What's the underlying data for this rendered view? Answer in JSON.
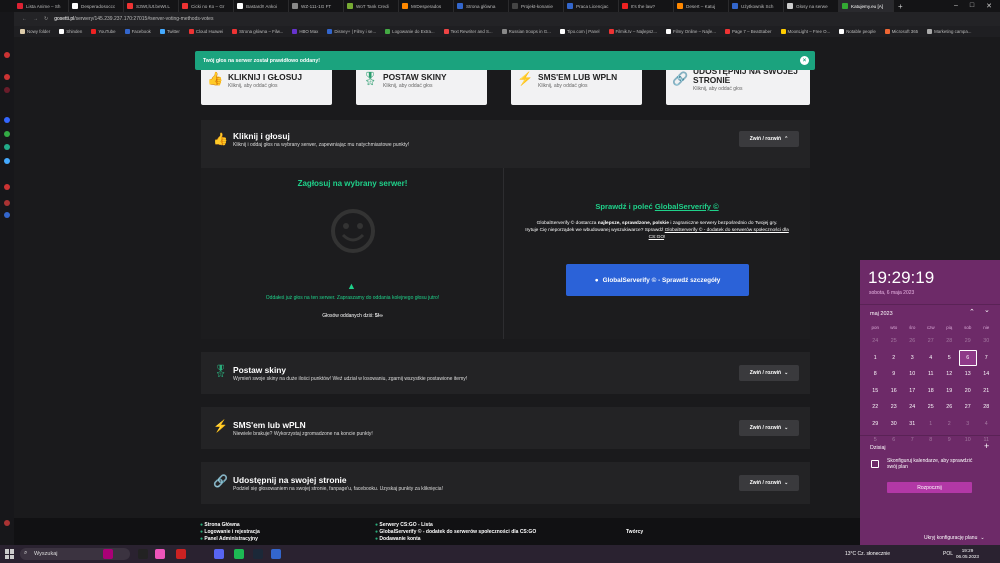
{
  "tabs": [
    {
      "label": "Lista Anime – Sh",
      "color": "#d23"
    },
    {
      "label": "Desperadosoccc",
      "color": "#fff"
    },
    {
      "label": "S3Wt,lUt.beWI.L",
      "color": "#e33"
    },
    {
      "label": "Cicki no Ko – Gr",
      "color": "#e33"
    },
    {
      "label": "Bastard!! Ankoi",
      "color": "#fff"
    },
    {
      "label": "WZ-111-1G FT",
      "color": "#888"
    },
    {
      "label": "WoT Tank Credi",
      "color": "#7a3"
    },
    {
      "label": "MrDesperados",
      "color": "#f80"
    },
    {
      "label": "Strona główna",
      "color": "#36c"
    },
    {
      "label": "Projekt-konanie",
      "color": "#444"
    },
    {
      "label": "Praca Licencjac",
      "color": "#36c"
    },
    {
      "label": "It's the law?",
      "color": "#e22"
    },
    {
      "label": "Desert – Katuj",
      "color": "#f80"
    },
    {
      "label": "Użytkownik Sch",
      "color": "#36c"
    },
    {
      "label": "Głosy na serwe",
      "color": "#ccc"
    },
    {
      "label": "Katujemy.eu [A]",
      "color": "#3a3"
    }
  ],
  "url": {
    "host": "gosetti.pl",
    "path": "/serwery/145.239.237.170:27015#server-voting-methods-votes"
  },
  "bookmarks": [
    {
      "label": "Nowy folder",
      "color": "#dca"
    },
    {
      "label": "Shinden",
      "color": "#fff"
    },
    {
      "label": "YouTube",
      "color": "#e22"
    },
    {
      "label": "Facebook",
      "color": "#36c"
    },
    {
      "label": "Twitter",
      "color": "#4af"
    },
    {
      "label": "Cloud Huawei",
      "color": "#e33"
    },
    {
      "label": "Strona główna – Filw...",
      "color": "#e33"
    },
    {
      "label": "HBO Max",
      "color": "#63c"
    },
    {
      "label": "Disney+ | Filmy i se...",
      "color": "#36c"
    },
    {
      "label": "Logowanie do Extra...",
      "color": "#4a4"
    },
    {
      "label": "Text Rewriter and S...",
      "color": "#e44"
    },
    {
      "label": "Russian troops in G...",
      "color": "#888"
    },
    {
      "label": "Tipo.com | Panel",
      "color": "#fff"
    },
    {
      "label": "Filmik.tv – Najlepsz...",
      "color": "#e33"
    },
    {
      "label": "Filmy Online – Najle...",
      "color": "#fff"
    },
    {
      "label": "Page 7 – BeatSaber",
      "color": "#e33"
    },
    {
      "label": "MoonLight – Free O...",
      "color": "#fc0"
    },
    {
      "label": "Notable people",
      "color": "#fff"
    },
    {
      "label": "Microsoft 365",
      "color": "#e63"
    },
    {
      "label": "Marketing campa...",
      "color": "#aaa"
    }
  ],
  "toast": {
    "text": "Twój głos na serwer został prawidłowo oddany!",
    "close": "×"
  },
  "cards": [
    {
      "title": "KLIKNIJ I GŁOSUJ",
      "sub": "Kliknij, aby oddać głos",
      "icon": "thumb-up-icon"
    },
    {
      "title": "POSTAW SKINY",
      "sub": "Kliknij, aby oddać głos",
      "icon": "award-icon"
    },
    {
      "title": "SMS'EM LUB WPLN",
      "sub": "Kliknij, aby oddać głos",
      "icon": "bolt-icon"
    },
    {
      "title": "UDOSTĘPNIJ NA SWOJEJ STRONIE",
      "sub": "Kliknij, aby oddać głos",
      "icon": "link-icon"
    }
  ],
  "section1": {
    "title": "Kliknij i głosuj",
    "sub": "Kliknij i oddaj głos na wybrany serwer, zapewniając mu natychmiastowe punkty!",
    "toggle": "Zwiń / rozwiń"
  },
  "vote": {
    "heading": "Zagłosuj na wybrany serwer!",
    "warning": "Oddałeś już głos na ten serwer. Zapraszamy do oddania kolejnego głosu jutro!",
    "count_label": "Głosów oddanych dziś:",
    "count_value": "5/∞"
  },
  "promo": {
    "heading_prefix": "Sprawdź i poleć ",
    "heading_link": "GlobalServerify ©",
    "text1": "GlobalServerify © dostarcza ",
    "bold1": "najlepsze, sprawdzone, polskie",
    "text2": " i zagraniczne serwery bezpośrednio do Twojej gry.",
    "text3": "Irytuje Cię nieporządek we wbudowanej wyszukiwarce? Sprawdź ",
    "link2": "GlobalServerify © - dodatek do serwerów społeczności dla CS:GO",
    "text4": "!",
    "button": "GlobalServerify © - Sprawdź szczegóły"
  },
  "sections": [
    {
      "title": "Postaw skiny",
      "sub": "Wymień swoje skiny na duże ilości punktów! Weź udział w losowaniu, zgarnij wszystkie postawione itemy!",
      "toggle": "Zwiń / rozwiń",
      "icon": "award-icon"
    },
    {
      "title": "SMS'em lub wPLN",
      "sub": "Niewiele brakuje? Wykorzystaj zgromadzone na koncie punkty!",
      "toggle": "Zwiń / rozwiń",
      "icon": "bolt-icon"
    },
    {
      "title": "Udostępnij na swojej stronie",
      "sub": "Podziel się głosowaniem na swojej stronie, fanpage'u, facebooku. Uzyskaj punkty za kliknięcia!",
      "toggle": "Zwiń / rozwiń",
      "icon": "link-icon"
    }
  ],
  "footer": {
    "col1": [
      "Strona Główna",
      "Logowanie i rejestracja",
      "Panel Administracyjny"
    ],
    "col2": [
      "Serwery CS:GO - Lista",
      "GlobalServerify © - dodatek do serwerów społeczności dla CS:GO",
      "Dodawanie konta"
    ],
    "col3": "Twórcy"
  },
  "calendar": {
    "time": "19:29:19",
    "date": "sobota, 6 maja 2023",
    "month": "maj 2023",
    "days": [
      "pon",
      "wto",
      "śro",
      "czw",
      "pią",
      "sob",
      "nie"
    ],
    "weeks": [
      [
        "24",
        "25",
        "26",
        "27",
        "28",
        "29",
        "30"
      ],
      [
        "1",
        "2",
        "3",
        "4",
        "5",
        "6",
        "7"
      ],
      [
        "8",
        "9",
        "10",
        "11",
        "12",
        "13",
        "14"
      ],
      [
        "15",
        "16",
        "17",
        "18",
        "19",
        "20",
        "21"
      ],
      [
        "22",
        "23",
        "24",
        "25",
        "26",
        "27",
        "28"
      ],
      [
        "29",
        "30",
        "31",
        "1",
        "2",
        "3",
        "4"
      ],
      [
        "5",
        "6",
        "7",
        "8",
        "9",
        "10",
        "11"
      ]
    ],
    "today_index": [
      1,
      5
    ],
    "agenda_label": "Dzisiaj",
    "event": "Skonfiguruj kalendarze, aby sprawdzić swój plan",
    "event_button": "Rozpocznij",
    "hide": "Ukryj konfigurację planu"
  },
  "taskbar": {
    "search": "Wyszukaj",
    "weather": "13°C  Cz. słonecznie",
    "lang": "POL",
    "time": "19:29",
    "date": "06.05.2023"
  }
}
